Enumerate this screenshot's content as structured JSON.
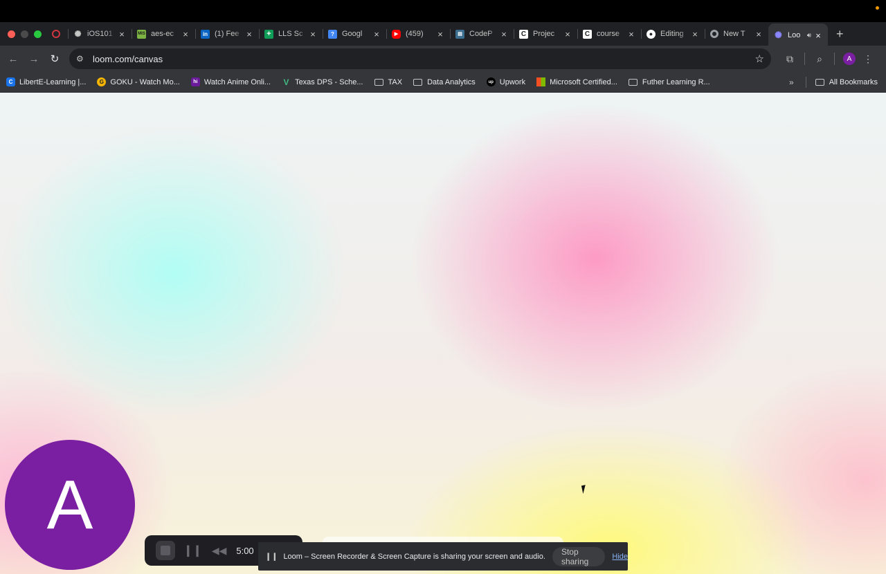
{
  "browser": {
    "tabs": [
      {
        "label": "",
        "favicon": "loom-record-icon",
        "color": "#d0363f"
      },
      {
        "label": "iOS101",
        "favicon": "openai-icon",
        "color": "#5f6368"
      },
      {
        "label": "aes-ec",
        "favicon": "mis-icon",
        "color": "#7cb342"
      },
      {
        "label": "(1) Fee",
        "favicon": "linkedin-icon",
        "color": "#0a66c2"
      },
      {
        "label": "LLS Sc",
        "favicon": "sheets-icon",
        "color": "#0f9d58"
      },
      {
        "label": "Googl",
        "favicon": "forms-icon",
        "color": "#4285f4"
      },
      {
        "label": "(459)",
        "favicon": "youtube-icon",
        "color": "#ff0000"
      },
      {
        "label": "CodeP",
        "favicon": "codepath-icon",
        "color": "#3b6e8f"
      },
      {
        "label": "Projec",
        "favicon": "coursera-c-icon",
        "color": "#ffffff"
      },
      {
        "label": "course",
        "favicon": "coursera-c-icon",
        "color": "#ffffff"
      },
      {
        "label": "Editing",
        "favicon": "github-icon",
        "color": "#ffffff"
      },
      {
        "label": "New T",
        "favicon": "chrome-icon",
        "color": "#9aa0a6"
      },
      {
        "label": "Loo",
        "favicon": "loom-icon",
        "color": "#625df5",
        "active": true
      }
    ],
    "url": "loom.com/canvas",
    "profile_initial": "A",
    "bookmarks": [
      {
        "label": "LibertE-Learning |...",
        "icon": "c-logo-icon",
        "color": "#1a73e8"
      },
      {
        "label": "GOKU - Watch Mo...",
        "icon": "goku-icon",
        "color": "#f4b400"
      },
      {
        "label": "Watch Anime Onli...",
        "icon": "hi-anime-icon",
        "color": "#6a1b9a"
      },
      {
        "label": "Texas DPS - Sche...",
        "icon": "vue-icon",
        "color": "#41b883"
      },
      {
        "label": "TAX",
        "icon": "folder-icon",
        "color": ""
      },
      {
        "label": "Data Analytics",
        "icon": "folder-icon",
        "color": ""
      },
      {
        "label": "Upwork",
        "icon": "upwork-icon",
        "color": "#000000"
      },
      {
        "label": "Microsoft Certified...",
        "icon": "microsoft-icon",
        "color": "#f25022"
      },
      {
        "label": "Futher Learning R...",
        "icon": "folder-icon",
        "color": ""
      }
    ],
    "all_bookmarks": "All Bookmarks"
  },
  "camera_bubble": {
    "initial": "A",
    "color": "#7b1fa2"
  },
  "recorder": {
    "time": "5:00"
  },
  "sharing_bar": {
    "message": "Loom – Screen Recorder & Screen Capture is sharing your screen and audio.",
    "stop_label": "Stop sharing",
    "hide_label": "Hide"
  }
}
